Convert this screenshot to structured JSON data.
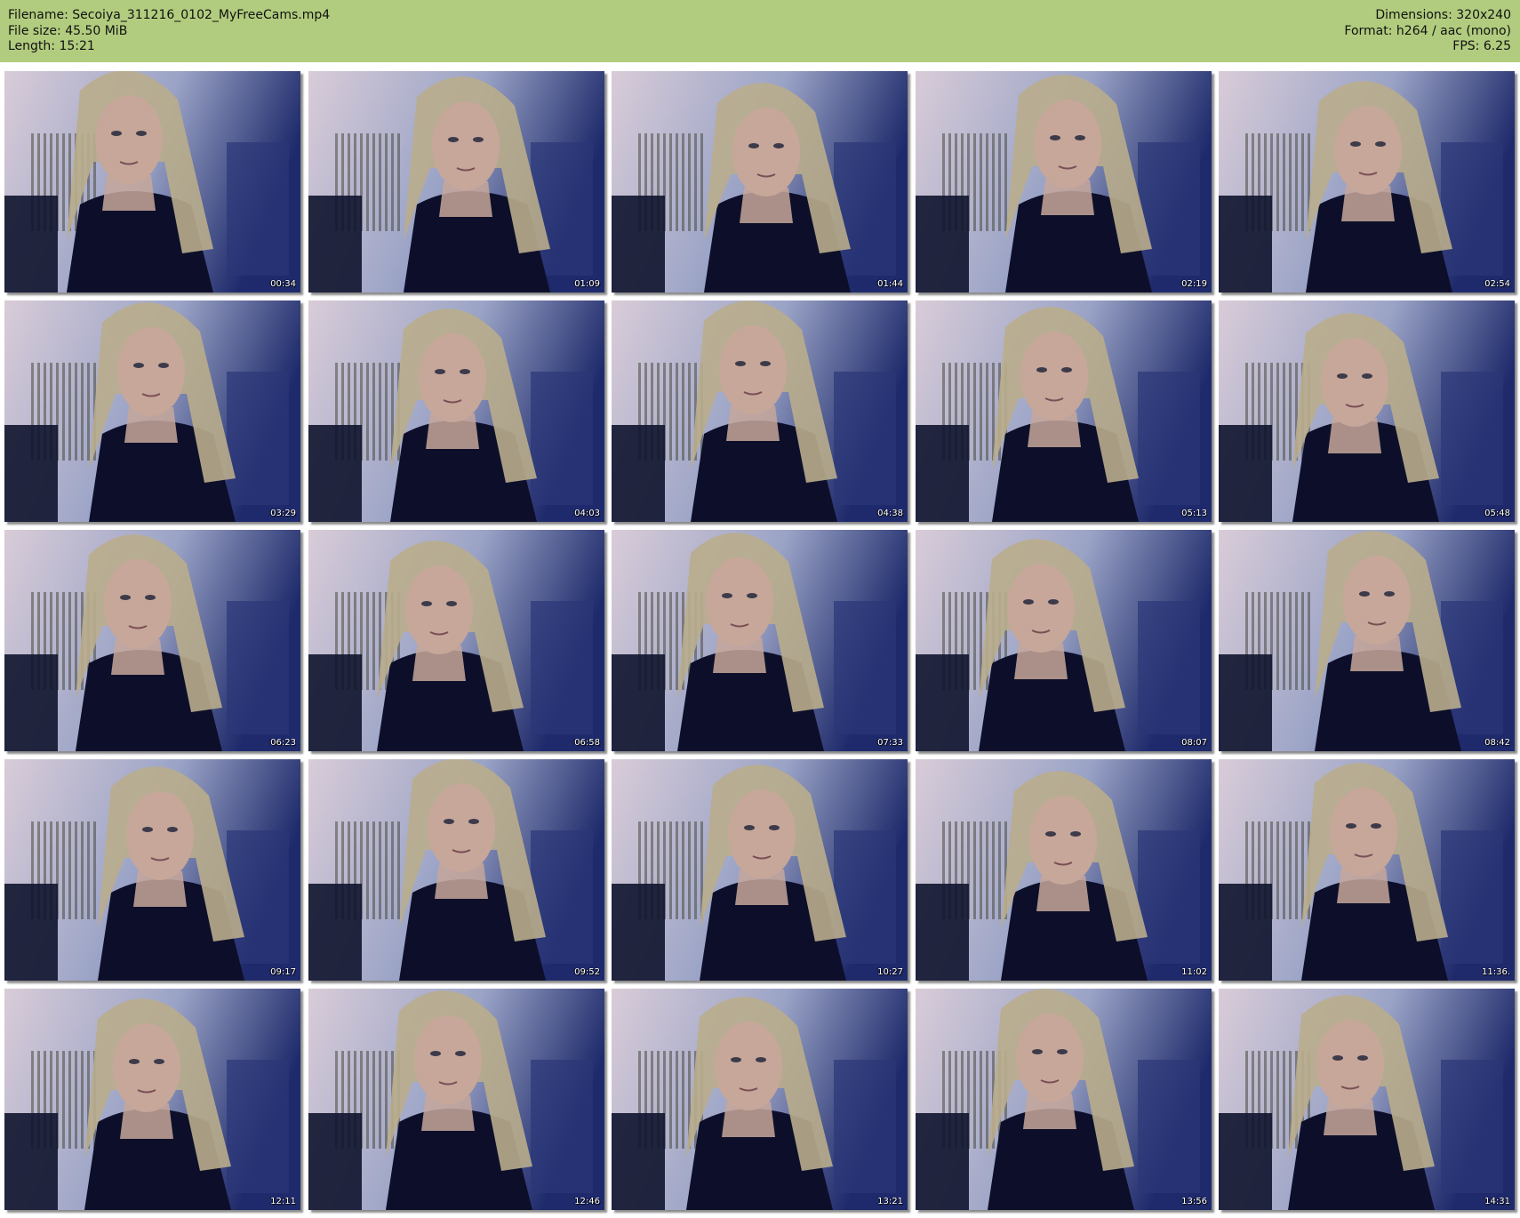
{
  "header": {
    "filename": "Filename: Secoiya_311216_0102_MyFreeCams.mp4",
    "file_size": "File size: 45.50 MiB",
    "length": "Length: 15:21",
    "dimensions": "Dimensions: 320x240",
    "format": "Format: h264 / aac (mono)",
    "fps": "FPS: 6.25"
  },
  "colors": {
    "header_bg": "#b1cc7e",
    "page_bg": "#ffffff",
    "wall": "#d9ccd8",
    "room_shadow": "#1e2a6b",
    "shirt": "#0d0f2a",
    "hair": "#b9ad8c",
    "skin": "#c7a79a"
  },
  "thumbnails": [
    {
      "timestamp": "00:34"
    },
    {
      "timestamp": "01:09"
    },
    {
      "timestamp": "01:44"
    },
    {
      "timestamp": "02:19"
    },
    {
      "timestamp": "02:54"
    },
    {
      "timestamp": "03:29"
    },
    {
      "timestamp": "04:03"
    },
    {
      "timestamp": "04:38"
    },
    {
      "timestamp": "05:13"
    },
    {
      "timestamp": "05:48"
    },
    {
      "timestamp": "06:23"
    },
    {
      "timestamp": "06:58"
    },
    {
      "timestamp": "07:33"
    },
    {
      "timestamp": "08:07"
    },
    {
      "timestamp": "08:42"
    },
    {
      "timestamp": "09:17"
    },
    {
      "timestamp": "09:52"
    },
    {
      "timestamp": "10:27"
    },
    {
      "timestamp": "11:02"
    },
    {
      "timestamp": "11:36."
    },
    {
      "timestamp": "12:11"
    },
    {
      "timestamp": "12:46"
    },
    {
      "timestamp": "13:21"
    },
    {
      "timestamp": "13:56"
    },
    {
      "timestamp": "14:31"
    }
  ]
}
